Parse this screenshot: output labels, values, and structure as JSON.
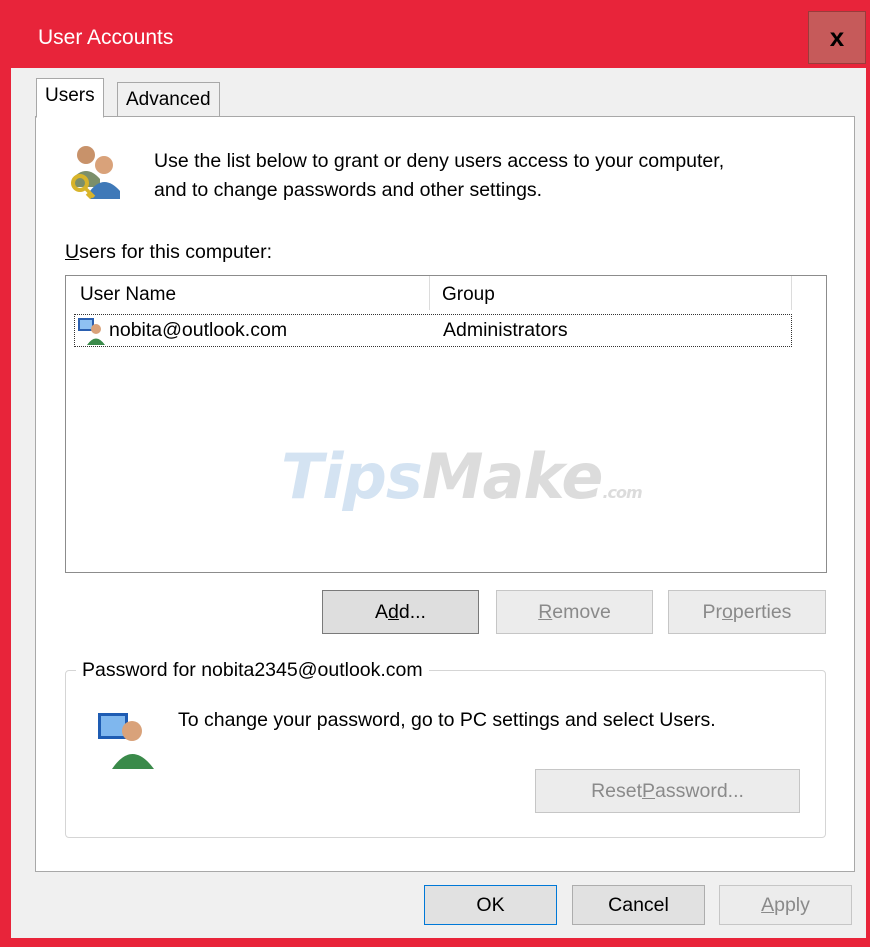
{
  "window": {
    "title": "User Accounts",
    "close_glyph": "x",
    "accent_color": "#e8243a"
  },
  "tabs": [
    {
      "label": "Users",
      "selected": true
    },
    {
      "label": "Advanced",
      "selected": false
    }
  ],
  "intro": {
    "icon": "users-keys-icon",
    "text_line1": "Use the list below to grant or deny users access to your computer,",
    "text_line2": "and to change passwords and other settings."
  },
  "users_list": {
    "label_first": "U",
    "label_rest": "sers for this computer:",
    "columns": [
      "User Name",
      "Group"
    ],
    "rows": [
      {
        "icon": "user-icon",
        "name": "nobita@outlook.com",
        "group": "Administrators"
      }
    ],
    "watermark": {
      "part1": "Tips",
      "part2": "Make",
      "part3": ".com"
    }
  },
  "list_buttons": {
    "add": {
      "pre": "A",
      "mnemonic": "d",
      "post": "d..."
    },
    "remove": {
      "pre": "",
      "mnemonic": "R",
      "post": "emove"
    },
    "properties": {
      "pre": "Pr",
      "mnemonic": "o",
      "post": "perties"
    }
  },
  "password": {
    "legend": "Password for nobita2345@outlook.com",
    "icon": "user-monitor-icon",
    "text": "To change your password, go to PC settings and select Users.",
    "reset": {
      "pre": "Reset ",
      "mnemonic": "P",
      "post": "assword..."
    }
  },
  "dialog_buttons": {
    "ok": "OK",
    "cancel": "Cancel",
    "apply": {
      "pre": "",
      "mnemonic": "A",
      "post": "pply"
    }
  }
}
